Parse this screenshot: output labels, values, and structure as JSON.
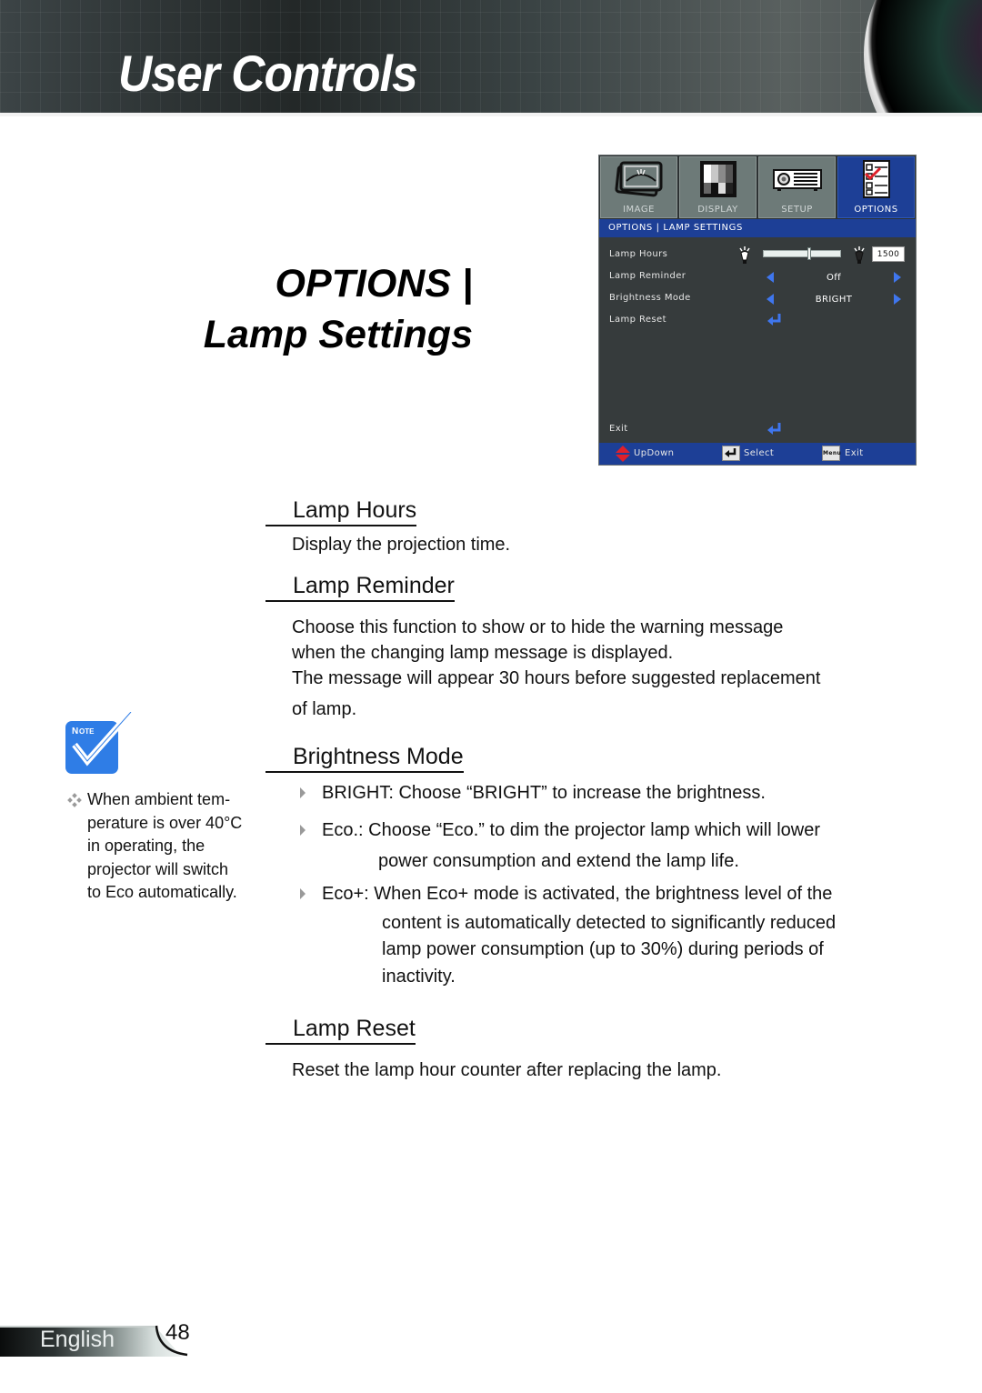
{
  "banner": {
    "title": "User Controls",
    "image": "projector-lens"
  },
  "section_title": {
    "line1": "OPTIONS |",
    "line2": "Lamp Settings"
  },
  "osd": {
    "tabs": [
      {
        "label": "IMAGE",
        "icon": "image-icon",
        "active": false
      },
      {
        "label": "DISPLAY",
        "icon": "display-icon",
        "active": false
      },
      {
        "label": "SETUP",
        "icon": "projector-icon",
        "active": false
      },
      {
        "label": "OPTIONS",
        "icon": "checklist-icon",
        "active": true
      }
    ],
    "breadcrumb": "OPTIONS | LAMP SETTINGS",
    "rows": [
      {
        "label": "Lamp Hours",
        "type": "slider",
        "value": "1500",
        "slider_fraction": 0.6
      },
      {
        "label": "Lamp Reminder",
        "type": "select",
        "value": "Off"
      },
      {
        "label": "Brightness Mode",
        "type": "select",
        "value": "BRIGHT"
      },
      {
        "label": "Lamp Reset",
        "type": "enter"
      }
    ],
    "exit_label": "Exit",
    "footer": {
      "updown": "UpDown",
      "select": "Select",
      "exit": "Exit",
      "menu_key": "Menu"
    },
    "colors": {
      "accent": "#1d3f96",
      "arrow": "#3f76ee",
      "panel": "#363b3c",
      "tab": "#6d7a78"
    }
  },
  "sections": {
    "lamp_hours": {
      "title": "Lamp Hours",
      "text": "Display the projection time."
    },
    "lamp_reminder": {
      "title": "Lamp Reminder",
      "lines": [
        "Choose this function to show or to hide the warning message",
        "when the changing lamp message is displayed.",
        "The message will appear 30 hours before suggested replacement",
        "of lamp."
      ]
    },
    "brightness_mode": {
      "title": "Brightness Mode",
      "bullets": [
        {
          "lines": [
            "BRIGHT: Choose “BRIGHT” to increase the brightness."
          ]
        },
        {
          "lines": [
            "Eco.: Choose “Eco.” to dim the projector lamp which will lower",
            "power consumption and extend the lamp life."
          ]
        },
        {
          "lines": [
            "Eco+: When Eco+ mode is activated, the brightness level of the",
            "content is automatically detected to significantly reduced",
            "lamp power consumption (up to 30%) during periods of",
            "inactivity."
          ]
        }
      ]
    },
    "lamp_reset": {
      "title": "Lamp Reset",
      "text": "Reset the lamp hour counter after replacing the lamp."
    }
  },
  "note": {
    "badge": "Note",
    "lines": [
      "When ambient tem-",
      "perature is over 40°C",
      "in operating, the",
      "projector will switch",
      "to Eco automatically."
    ],
    "color": "#2f7de6"
  },
  "footer": {
    "language": "English",
    "page_number": "48"
  }
}
